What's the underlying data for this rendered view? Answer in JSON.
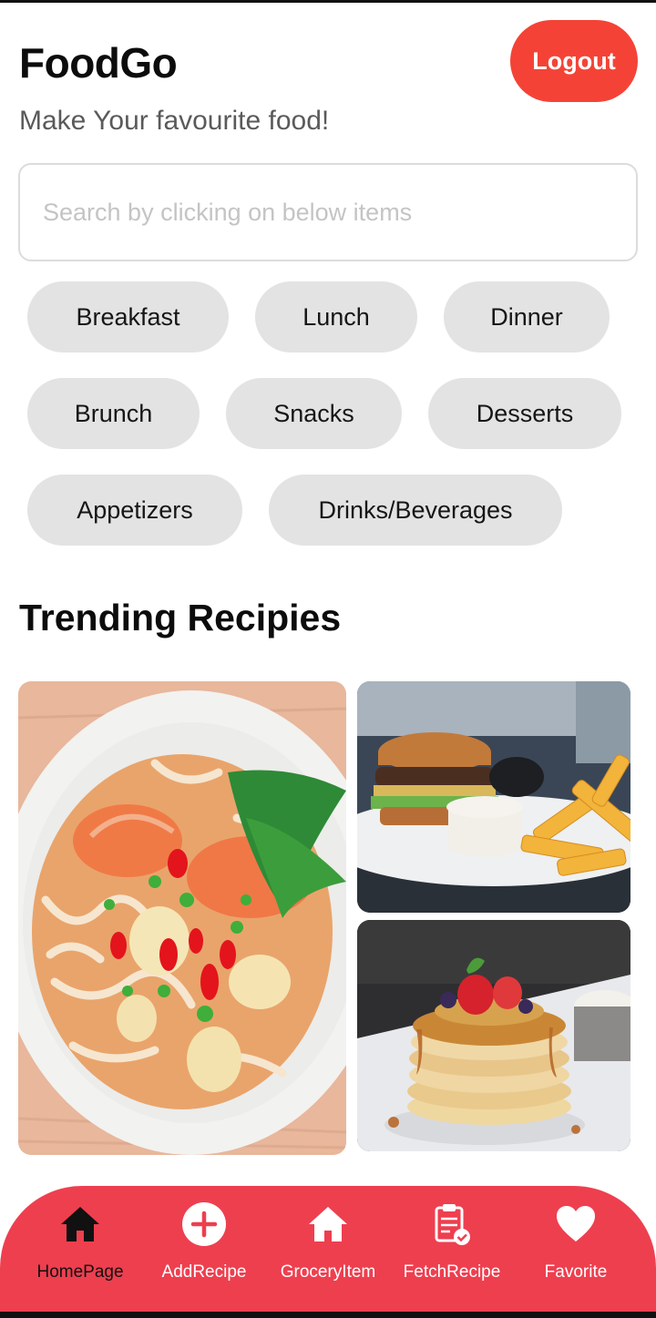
{
  "header": {
    "app_title": "FoodGo",
    "tagline": "Make Your favourite food!",
    "logout_label": "Logout"
  },
  "search": {
    "placeholder": "Search by clicking on below items",
    "value": ""
  },
  "categories": [
    "Breakfast",
    "Lunch",
    "Dinner",
    "Brunch",
    "Snacks",
    "Desserts",
    "Appetizers",
    "Drinks/Beverages"
  ],
  "trending": {
    "title": "Trending Recipies",
    "images": [
      "noodle-soup-image",
      "burger-fries-image",
      "pancake-stack-image"
    ]
  },
  "bottom_nav": {
    "items": [
      {
        "label": "HomePage",
        "icon": "home-icon",
        "active": true
      },
      {
        "label": "AddRecipe",
        "icon": "add-circle-icon",
        "active": false
      },
      {
        "label": "GroceryItem",
        "icon": "house-icon",
        "active": false
      },
      {
        "label": "FetchRecipe",
        "icon": "clipboard-check-icon",
        "active": false
      },
      {
        "label": "Favorite",
        "icon": "heart-icon",
        "active": false
      }
    ]
  },
  "colors": {
    "accent": "#f44336",
    "nav_bg": "#ee3f4f",
    "chip_bg": "#e3e3e3"
  }
}
